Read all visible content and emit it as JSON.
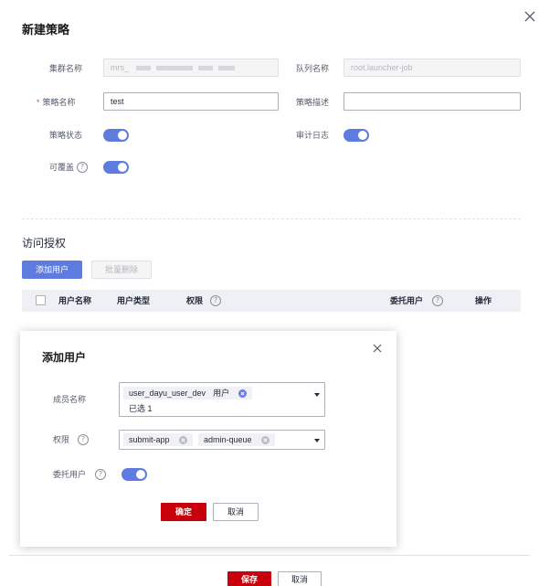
{
  "page": {
    "title": "新建策略"
  },
  "form": {
    "cluster_name_label": "集群名称",
    "cluster_name_value": "mrs_",
    "queue_name_label": "队列名称",
    "queue_name_value": "root.launcher-job",
    "policy_name_label": "策略名称",
    "policy_name_value": "test",
    "policy_desc_label": "策略描述",
    "policy_desc_value": "",
    "policy_status_label": "策略状态",
    "policy_status_on": true,
    "audit_log_label": "审计日志",
    "audit_log_on": true,
    "overridable_label": "可覆盖",
    "overridable_on": true,
    "help_glyph": "?"
  },
  "access": {
    "title": "访问授权",
    "add_user_button": "添加用户",
    "batch_delete_button": "批量删除",
    "columns": [
      "用户名称",
      "用户类型",
      "权限",
      "委托用户",
      "操作"
    ]
  },
  "modal": {
    "title": "添加用户",
    "member_label": "成员名称",
    "member_tag_name": "user_dayu_user_dev",
    "member_tag_type": "用户",
    "selected_count": "已选 1",
    "permission_label": "权限",
    "permission_tags": [
      "submit-app",
      "admin-queue"
    ],
    "delegate_label": "委托用户",
    "delegate_on": true,
    "confirm_button": "确定",
    "cancel_button": "取消"
  },
  "footer": {
    "save_button": "保存",
    "cancel_button": "取消"
  },
  "colors": {
    "accent": "#5e7ce0",
    "danger": "#c7000b",
    "required": "#e54545"
  }
}
